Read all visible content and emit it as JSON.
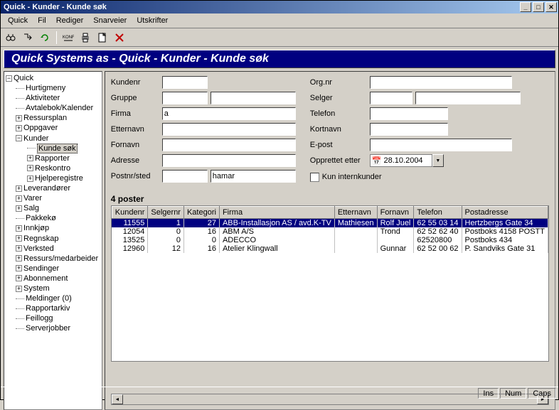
{
  "window": {
    "title": "Quick - Kunder - Kunde søk"
  },
  "menu": {
    "items": [
      "Quick",
      "Fil",
      "Rediger",
      "Snarveier",
      "Utskrifter"
    ]
  },
  "header": {
    "text": "Quick Systems as - Quick - Kunder - Kunde søk"
  },
  "tree": {
    "root": "Quick",
    "items": [
      {
        "label": "Hurtigmeny",
        "indent": 1,
        "exp": ""
      },
      {
        "label": "Aktiviteter",
        "indent": 1,
        "exp": ""
      },
      {
        "label": "Avtalebok/Kalender",
        "indent": 1,
        "exp": ""
      },
      {
        "label": "Ressursplan",
        "indent": 1,
        "exp": "+"
      },
      {
        "label": "Oppgaver",
        "indent": 1,
        "exp": "+"
      },
      {
        "label": "Kunder",
        "indent": 1,
        "exp": "−"
      },
      {
        "label": "Kunde søk",
        "indent": 2,
        "exp": "",
        "selected": true
      },
      {
        "label": "Rapporter",
        "indent": 2,
        "exp": "+"
      },
      {
        "label": "Reskontro",
        "indent": 2,
        "exp": "+"
      },
      {
        "label": "Hjelperegistre",
        "indent": 2,
        "exp": "+"
      },
      {
        "label": "Leverandører",
        "indent": 1,
        "exp": "+"
      },
      {
        "label": "Varer",
        "indent": 1,
        "exp": "+"
      },
      {
        "label": "Salg",
        "indent": 1,
        "exp": "+"
      },
      {
        "label": "Pakkekø",
        "indent": 1,
        "exp": ""
      },
      {
        "label": "Innkjøp",
        "indent": 1,
        "exp": "+"
      },
      {
        "label": "Regnskap",
        "indent": 1,
        "exp": "+"
      },
      {
        "label": "Verksted",
        "indent": 1,
        "exp": "+"
      },
      {
        "label": "Ressurs/medarbeider",
        "indent": 1,
        "exp": "+"
      },
      {
        "label": "Sendinger",
        "indent": 1,
        "exp": "+"
      },
      {
        "label": "Abonnement",
        "indent": 1,
        "exp": "+"
      },
      {
        "label": "System",
        "indent": 1,
        "exp": "+"
      },
      {
        "label": "Meldinger (0)",
        "indent": 1,
        "exp": ""
      },
      {
        "label": "Rapportarkiv",
        "indent": 1,
        "exp": ""
      },
      {
        "label": "Feillogg",
        "indent": 1,
        "exp": ""
      },
      {
        "label": "Serverjobber",
        "indent": 1,
        "exp": ""
      }
    ]
  },
  "form": {
    "kundenr_label": "Kundenr",
    "kundenr_val": "",
    "gruppe_label": "Gruppe",
    "gruppe_val": "",
    "gruppe_text": "",
    "firma_label": "Firma",
    "firma_val": "a",
    "etternavn_label": "Etternavn",
    "etternavn_val": "",
    "fornavn_label": "Fornavn",
    "fornavn_val": "",
    "adresse_label": "Adresse",
    "adresse_val": "",
    "postnr_label": "Postnr/sted",
    "postnr_val": "",
    "sted_val": "hamar",
    "orgnr_label": "Org.nr",
    "orgnr_val": "",
    "selger_label": "Selger",
    "selger_val": "",
    "selger_text": "",
    "telefon_label": "Telefon",
    "telefon_val": "",
    "kortnavn_label": "Kortnavn",
    "kortnavn_val": "",
    "epost_label": "E-post",
    "epost_val": "",
    "opprettet_label": "Opprettet etter",
    "opprettet_val": "28.10.2004",
    "intern_label": "Kun internkunder"
  },
  "results": {
    "count_text": "4 poster",
    "columns": [
      "Kundenr",
      "Selgernr",
      "Kategori",
      "Firma",
      "Etternavn",
      "Fornavn",
      "Telefon",
      "Postadresse"
    ],
    "rows": [
      {
        "kundenr": "11555",
        "selgernr": "1",
        "kategori": "27",
        "firma": "ABB-Installasjon AS / avd.K-TV",
        "etternavn": "Mathiesen",
        "fornavn": "Rolf Juel",
        "telefon": "62 55 03 14",
        "postadr": "Hertzbergs Gate 34",
        "selected": true
      },
      {
        "kundenr": "12054",
        "selgernr": "0",
        "kategori": "16",
        "firma": "ABM A/S",
        "etternavn": "",
        "fornavn": "Trond",
        "telefon": "62 52 62 40",
        "postadr": "Postboks 4158 POSTT"
      },
      {
        "kundenr": "13525",
        "selgernr": "0",
        "kategori": "0",
        "firma": "ADECCO",
        "etternavn": "",
        "fornavn": "",
        "telefon": "62520800",
        "postadr": "Postboks 434"
      },
      {
        "kundenr": "12960",
        "selgernr": "12",
        "kategori": "16",
        "firma": "Atelier Klingwall",
        "etternavn": "",
        "fornavn": "Gunnar",
        "telefon": "62 52 00 62",
        "postadr": "P. Sandviks Gate 31"
      }
    ]
  },
  "status": {
    "ins": "Ins",
    "num": "Num",
    "caps": "Caps"
  }
}
